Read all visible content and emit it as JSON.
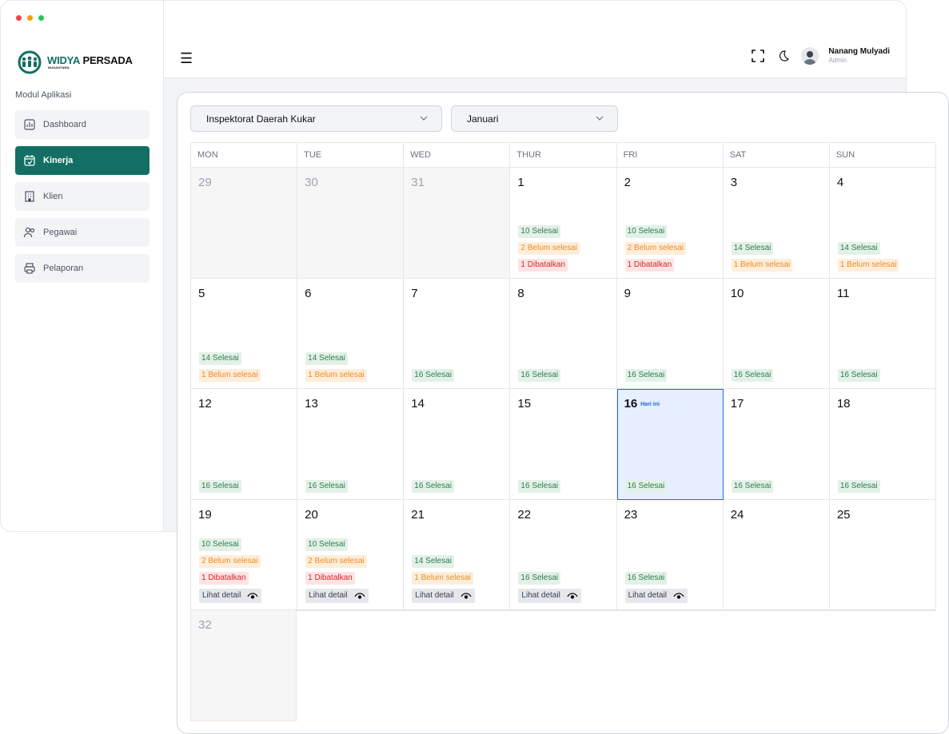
{
  "colors": {
    "brand": "#136f63",
    "today_outline": "#2563eb",
    "done": "#2f7d4e",
    "pending": "#f08a24",
    "cancel": "#dc2626"
  },
  "brand": {
    "name_part1": "WIDYA",
    "name_part2": " PERSADA",
    "subtitle": "NUSANTARA"
  },
  "sidebar": {
    "section_label": "Modul Aplikasi",
    "items": [
      {
        "label": "Dashboard",
        "icon": "chart-icon",
        "active": false
      },
      {
        "label": "Kinerja",
        "icon": "calendar-edit-icon",
        "active": true
      },
      {
        "label": "Klien",
        "icon": "building-icon",
        "active": false
      },
      {
        "label": "Pegawai",
        "icon": "users-icon",
        "active": false
      },
      {
        "label": "Pelaporan",
        "icon": "printer-icon",
        "active": false
      }
    ]
  },
  "topbar": {
    "user_name": "Nanang Mulyadi",
    "user_role": "Admin"
  },
  "filters": {
    "client": "Inspektorat Daerah Kukar",
    "month": "Januari"
  },
  "calendar": {
    "headers": [
      "MON",
      "TUE",
      "WED",
      "THUR",
      "FRI",
      "SAT",
      "SUN"
    ],
    "today_label": "Hari ini",
    "detail_label": "Lihat detail",
    "weeks": [
      [
        {
          "num": "29",
          "muted": true,
          "tags": []
        },
        {
          "num": "30",
          "muted": true,
          "tags": []
        },
        {
          "num": "31",
          "muted": true,
          "tags": []
        },
        {
          "num": "1",
          "tags": [
            [
              "done",
              "10 Selesai"
            ],
            [
              "pending",
              "2 Belum selesai"
            ],
            [
              "cancel",
              "1 Dibatalkan"
            ]
          ]
        },
        {
          "num": "2",
          "tags": [
            [
              "done",
              "10 Selesai"
            ],
            [
              "pending",
              "2 Belum selesai"
            ],
            [
              "cancel",
              "1 Dibatalkan"
            ]
          ]
        },
        {
          "num": "3",
          "tags": [
            [
              "done",
              "14 Selesai"
            ],
            [
              "pending",
              "1 Belum selesai"
            ]
          ]
        },
        {
          "num": "4",
          "tags": [
            [
              "done",
              "14 Selesai"
            ],
            [
              "pending",
              "1 Belum selesai"
            ]
          ]
        }
      ],
      [
        {
          "num": "5",
          "tags": [
            [
              "done",
              "14 Selesai"
            ],
            [
              "pending",
              "1 Belum selesai"
            ]
          ]
        },
        {
          "num": "6",
          "tags": [
            [
              "done",
              "14 Selesai"
            ],
            [
              "pending",
              "1 Belum selesai"
            ]
          ]
        },
        {
          "num": "7",
          "tags": [
            [
              "done",
              "16 Selesai"
            ]
          ]
        },
        {
          "num": "8",
          "tags": [
            [
              "done",
              "16 Selesai"
            ]
          ]
        },
        {
          "num": "9",
          "tags": [
            [
              "done",
              "16 Selesai"
            ]
          ]
        },
        {
          "num": "10",
          "tags": [
            [
              "done",
              "16 Selesai"
            ]
          ]
        },
        {
          "num": "11",
          "tags": [
            [
              "done",
              "16 Selesai"
            ]
          ]
        }
      ],
      [
        {
          "num": "12",
          "tags": [
            [
              "done",
              "16 Selesai"
            ]
          ]
        },
        {
          "num": "13",
          "tags": [
            [
              "done",
              "16 Selesai"
            ]
          ]
        },
        {
          "num": "14",
          "tags": [
            [
              "done",
              "16 Selesai"
            ]
          ]
        },
        {
          "num": "15",
          "tags": [
            [
              "done",
              "16 Selesai"
            ]
          ]
        },
        {
          "num": "16",
          "today": true,
          "tags": [
            [
              "done",
              "16 Selesai"
            ]
          ]
        },
        {
          "num": "17",
          "tags": [
            [
              "done",
              "16 Selesai"
            ]
          ]
        },
        {
          "num": "18",
          "tags": [
            [
              "done",
              "16 Selesai"
            ]
          ]
        }
      ],
      [
        {
          "num": "19",
          "detail": true,
          "tags": [
            [
              "done",
              "10 Selesai"
            ],
            [
              "pending",
              "2 Belum selesai"
            ],
            [
              "cancel",
              "1 Dibatalkan"
            ]
          ]
        },
        {
          "num": "20",
          "detail": true,
          "tags": [
            [
              "done",
              "10 Selesai"
            ],
            [
              "pending",
              "2 Belum selesai"
            ],
            [
              "cancel",
              "1 Dibatalkan"
            ]
          ]
        },
        {
          "num": "21",
          "detail": true,
          "tags": [
            [
              "done",
              "14 Selesai"
            ],
            [
              "pending",
              "1 Belum selesai"
            ]
          ]
        },
        {
          "num": "22",
          "detail": true,
          "tags": [
            [
              "done",
              "16 Selesai"
            ]
          ]
        },
        {
          "num": "23",
          "detail": true,
          "tags": [
            [
              "done",
              "16 Selesai"
            ]
          ]
        },
        {
          "num": "24",
          "tags": []
        },
        {
          "num": "25",
          "tags": []
        }
      ]
    ],
    "overflow_day": "32"
  }
}
